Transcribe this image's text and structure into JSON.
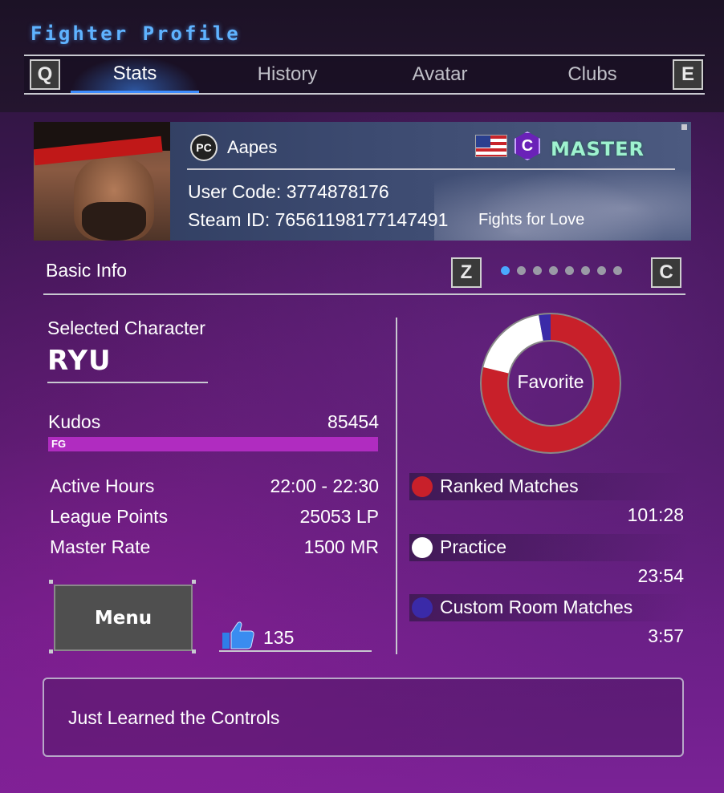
{
  "header": {
    "title": "Fighter Profile",
    "left_key": "Q",
    "right_key": "E",
    "tabs": [
      {
        "label": "Stats",
        "active": true
      },
      {
        "label": "History",
        "active": false
      },
      {
        "label": "Avatar",
        "active": false
      },
      {
        "label": "Clubs",
        "active": false
      }
    ]
  },
  "profile": {
    "platform": "PC",
    "name": "Aapes",
    "club_letter": "C",
    "rank": "MASTER",
    "user_code": "User Code: 3774878176",
    "steam_id": "Steam ID: 76561198177147491",
    "title_banner": "Fights for Love"
  },
  "basic_info": {
    "title": "Basic Info",
    "left_key": "Z",
    "right_key": "C",
    "page_dots": 8,
    "active_dot": 0,
    "selected_character_label": "Selected Character",
    "selected_character": "RYU",
    "kudos_label": "Kudos",
    "kudos_value": "85454",
    "kudos_rank": "FG",
    "kudos_progress": 1.0,
    "active_hours_label": "Active Hours",
    "active_hours_value": "22:00 - 22:30",
    "league_points_label": "League Points",
    "league_points_value": "25053 LP",
    "master_rate_label": "Master Rate",
    "master_rate_value": "1500 MR",
    "menu_label": "Menu",
    "likes": "135"
  },
  "playtime": {
    "center_label": "Favorite",
    "items": [
      {
        "label": "Ranked Matches",
        "time": "101:28",
        "color": "#c8202a",
        "share": 0.787
      },
      {
        "label": "Practice",
        "time": "23:54",
        "color": "#ffffff",
        "share": 0.185
      },
      {
        "label": "Custom Room Matches",
        "time": "3:57",
        "color": "#3a2aa8",
        "share": 0.028
      }
    ]
  },
  "fighter_title": "Just Learned the Controls",
  "colors": {
    "accent": "#3d8cff",
    "title": "#5fb3ff",
    "kudos": "#b02cc0",
    "rank": "#9ef2cf"
  }
}
